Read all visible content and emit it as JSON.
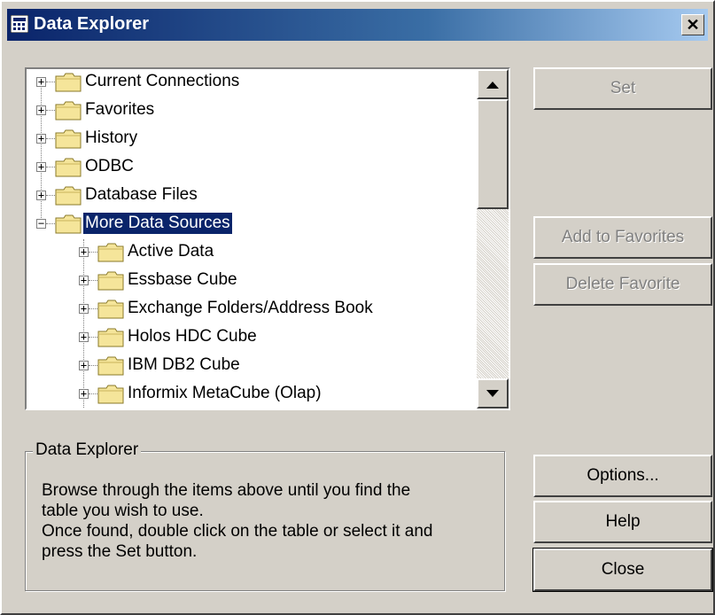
{
  "window": {
    "title": "Data Explorer",
    "close_glyph": "✕"
  },
  "tree": {
    "items": [
      {
        "label": "Current Connections",
        "expander": "+",
        "level": 0
      },
      {
        "label": "Favorites",
        "expander": "+",
        "level": 0
      },
      {
        "label": "History",
        "expander": "+",
        "level": 0
      },
      {
        "label": "ODBC",
        "expander": "+",
        "level": 0
      },
      {
        "label": "Database Files",
        "expander": "+",
        "level": 0
      },
      {
        "label": "More Data Sources",
        "expander": "−",
        "level": 0,
        "selected": true
      },
      {
        "label": "Active Data",
        "expander": "+",
        "level": 1
      },
      {
        "label": "Essbase Cube",
        "expander": "+",
        "level": 1
      },
      {
        "label": "Exchange Folders/Address Book",
        "expander": "+",
        "level": 1
      },
      {
        "label": "Holos HDC Cube",
        "expander": "+",
        "level": 1
      },
      {
        "label": "IBM DB2 Cube",
        "expander": "+",
        "level": 1
      },
      {
        "label": "Informix MetaCube (Olap)",
        "expander": "+",
        "level": 1
      }
    ]
  },
  "buttons": {
    "set": "Set",
    "add_to_favorites": "Add to Favorites",
    "delete_favorite": "Delete Favorite",
    "options": "Options...",
    "help": "Help",
    "close": "Close"
  },
  "groupbox": {
    "title": "Data Explorer",
    "line1": "Browse through the items above until you find the",
    "line2": "table you wish to use.",
    "line3": "Once found, double click on the table or select it and",
    "line4": "press the Set button."
  },
  "colors": {
    "face": "#d4d0c8",
    "title_start": "#0a246a",
    "title_end": "#a6caf0",
    "selection": "#0a246a"
  }
}
